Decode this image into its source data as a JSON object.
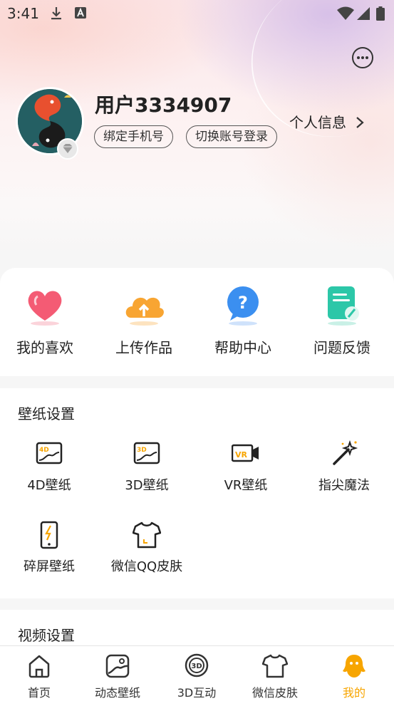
{
  "status_bar": {
    "time": "3:41",
    "icons": [
      "download-icon",
      "text-a-icon",
      "wifi-icon",
      "signal-icon",
      "battery-icon"
    ]
  },
  "header": {
    "message_icon": "chat-bubble-icon",
    "username": "用户3334907",
    "bind_phone_label": "绑定手机号",
    "switch_account_label": "切换账号登录",
    "profile_link_label": "个人信息",
    "profile_link_icon": "chevron-right-icon"
  },
  "quick_actions": [
    {
      "label": "我的喜欢",
      "icon": "heart-icon",
      "color": "#f45b74"
    },
    {
      "label": "上传作品",
      "icon": "cloud-upload-icon",
      "color": "#f8a532"
    },
    {
      "label": "帮助中心",
      "icon": "help-bubble-icon",
      "color": "#3b8ff0"
    },
    {
      "label": "问题反馈",
      "icon": "feedback-doc-icon",
      "color": "#2cc7a8"
    }
  ],
  "wallpaper_settings": {
    "title": "壁纸设置",
    "items": [
      {
        "label": "4D壁纸",
        "icon": "4d-wallpaper-icon"
      },
      {
        "label": "3D壁纸",
        "icon": "3d-wallpaper-icon"
      },
      {
        "label": "VR壁纸",
        "icon": "vr-camera-icon"
      },
      {
        "label": "指尖魔法",
        "icon": "magic-wand-icon"
      },
      {
        "label": "碎屏壁纸",
        "icon": "broken-phone-icon"
      },
      {
        "label": "微信QQ皮肤",
        "icon": "tshirt-icon"
      }
    ]
  },
  "video_settings": {
    "title": "视频设置"
  },
  "bottom_nav": [
    {
      "label": "首页",
      "icon": "home-icon",
      "active": false
    },
    {
      "label": "动态壁纸",
      "icon": "dynamic-wallpaper-icon",
      "active": false
    },
    {
      "label": "3D互动",
      "icon": "3d-interact-icon",
      "active": false
    },
    {
      "label": "微信皮肤",
      "icon": "tshirt-icon",
      "active": false
    },
    {
      "label": "我的",
      "icon": "profile-icon",
      "active": true
    }
  ],
  "colors": {
    "accent": "#f7a500",
    "text": "#222222",
    "background": "#f6f6f6"
  }
}
